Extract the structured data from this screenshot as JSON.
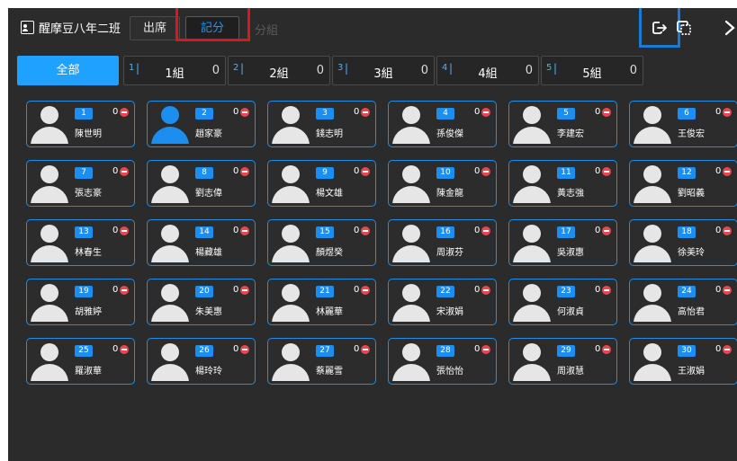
{
  "header": {
    "class_name": "醒摩豆八年二班",
    "tabs": {
      "attendance": "出席",
      "score": "記分",
      "group": "分組"
    }
  },
  "groups": [
    {
      "label": "全部"
    },
    {
      "num": "1",
      "name": "1組",
      "count": "0"
    },
    {
      "num": "2",
      "name": "2組",
      "count": "0"
    },
    {
      "num": "3",
      "name": "3組",
      "count": "0"
    },
    {
      "num": "4",
      "name": "4組",
      "count": "0"
    },
    {
      "num": "5",
      "name": "5組",
      "count": "0"
    }
  ],
  "students": [
    {
      "num": "1",
      "name": "陳世明",
      "score": "0",
      "avatar_color": "#e6e6e6"
    },
    {
      "num": "2",
      "name": "趙家豪",
      "score": "0",
      "avatar_color": "#1c8ef0"
    },
    {
      "num": "3",
      "name": "錢志明",
      "score": "0",
      "avatar_color": "#e6e6e6"
    },
    {
      "num": "4",
      "name": "孫俊傑",
      "score": "0",
      "avatar_color": "#e6e6e6"
    },
    {
      "num": "5",
      "name": "李建宏",
      "score": "0",
      "avatar_color": "#e6e6e6"
    },
    {
      "num": "6",
      "name": "王俊宏",
      "score": "0",
      "avatar_color": "#e6e6e6"
    },
    {
      "num": "7",
      "name": "張志豪",
      "score": "0",
      "avatar_color": "#e6e6e6"
    },
    {
      "num": "8",
      "name": "劉志偉",
      "score": "0",
      "avatar_color": "#e6e6e6"
    },
    {
      "num": "9",
      "name": "楊文雄",
      "score": "0",
      "avatar_color": "#e6e6e6"
    },
    {
      "num": "10",
      "name": "陳金龍",
      "score": "0",
      "avatar_color": "#e6e6e6"
    },
    {
      "num": "11",
      "name": "黃志強",
      "score": "0",
      "avatar_color": "#e6e6e6"
    },
    {
      "num": "12",
      "name": "劉昭義",
      "score": "0",
      "avatar_color": "#e6e6e6"
    },
    {
      "num": "13",
      "name": "林春生",
      "score": "0",
      "avatar_color": "#e6e6e6"
    },
    {
      "num": "14",
      "name": "楊藏雄",
      "score": "0",
      "avatar_color": "#e6e6e6"
    },
    {
      "num": "15",
      "name": "顏煜癸",
      "score": "0",
      "avatar_color": "#e6e6e6"
    },
    {
      "num": "16",
      "name": "周淑芬",
      "score": "0",
      "avatar_color": "#e6e6e6"
    },
    {
      "num": "17",
      "name": "吳淑惠",
      "score": "0",
      "avatar_color": "#e6e6e6"
    },
    {
      "num": "18",
      "name": "徐美玲",
      "score": "0",
      "avatar_color": "#e6e6e6"
    },
    {
      "num": "19",
      "name": "胡雅婷",
      "score": "0",
      "avatar_color": "#e6e6e6"
    },
    {
      "num": "20",
      "name": "朱美惠",
      "score": "0",
      "avatar_color": "#e6e6e6"
    },
    {
      "num": "21",
      "name": "林麗華",
      "score": "0",
      "avatar_color": "#e6e6e6"
    },
    {
      "num": "22",
      "name": "宋淑娟",
      "score": "0",
      "avatar_color": "#e6e6e6"
    },
    {
      "num": "23",
      "name": "何淑貞",
      "score": "0",
      "avatar_color": "#e6e6e6"
    },
    {
      "num": "24",
      "name": "高怡君",
      "score": "0",
      "avatar_color": "#e6e6e6"
    },
    {
      "num": "25",
      "name": "羅淑華",
      "score": "0",
      "avatar_color": "#e6e6e6"
    },
    {
      "num": "26",
      "name": "楊玲玲",
      "score": "0",
      "avatar_color": "#e6e6e6"
    },
    {
      "num": "27",
      "name": "蔡麗雪",
      "score": "0",
      "avatar_color": "#e6e6e6"
    },
    {
      "num": "28",
      "name": "張怡怡",
      "score": "0",
      "avatar_color": "#e6e6e6"
    },
    {
      "num": "29",
      "name": "周淑慧",
      "score": "0",
      "avatar_color": "#e6e6e6"
    },
    {
      "num": "30",
      "name": "王淑娟",
      "score": "0",
      "avatar_color": "#e6e6e6"
    }
  ],
  "icons": {
    "class": "class-roster-icon",
    "export": "share-exit-icon",
    "screenshot": "screenshot-icon",
    "close": "close-icon"
  },
  "colors": {
    "accent": "#1fa1ff",
    "card_border": "#1f8ee6",
    "minus": "#e8474f",
    "background": "#2b2b2b"
  }
}
